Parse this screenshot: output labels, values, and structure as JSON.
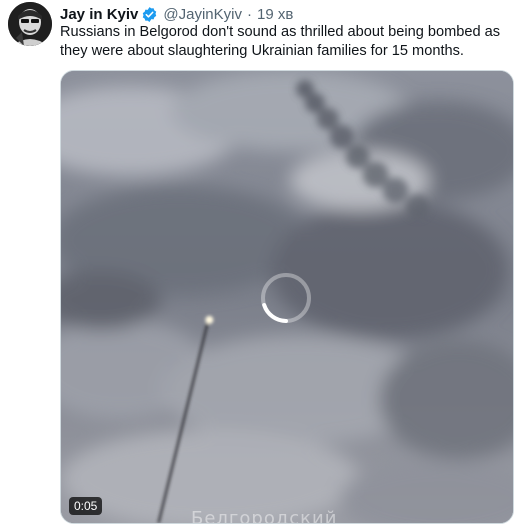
{
  "tweet": {
    "display_name": "Jay in Kyiv",
    "handle": "@JayinKyiv",
    "separator": "·",
    "time": "19 хв",
    "text": "Russians in Belgorod don't sound as thrilled about being bombed as they were about slaughtering Ukrainian families for 15 months.",
    "verified_icon": "verified-badge-icon",
    "verified_color": "#1d9bf0"
  },
  "media": {
    "type": "video",
    "duration": "0:05",
    "loading_icon": "loading-spinner-icon",
    "watermark": "Белгородский"
  }
}
